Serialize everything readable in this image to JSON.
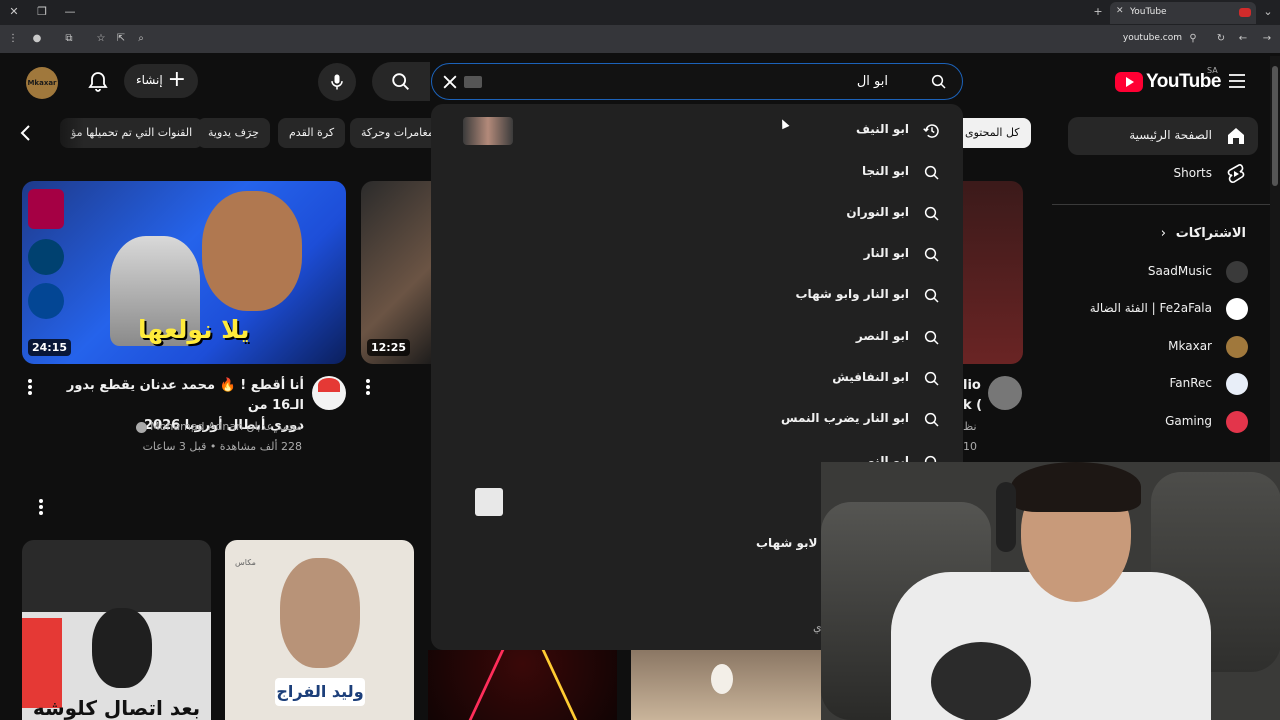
{
  "browser": {
    "tab_title": "YouTube",
    "url": "youtube.com"
  },
  "header": {
    "create_label": "إنشاء",
    "search_query": "ابو ال",
    "logo_text": "YouTube",
    "country_code": "SA",
    "avatar_label": "Mkaxar"
  },
  "chips": [
    {
      "label": "كل المحتوى"
    },
    {
      "label": "مغامرات وحركة"
    },
    {
      "label": "كرة القدم"
    },
    {
      "label": "حِرَف يدوية"
    },
    {
      "label": "القنوات التي تم تحميلها مؤ"
    }
  ],
  "sidebar": {
    "home": "الصفحة الرئيسية",
    "shorts": "Shorts",
    "subscriptions": "الاشتراكات",
    "channels": [
      {
        "name": "SaadMusic",
        "color": "#3a3a3a"
      },
      {
        "name": "Fe2aFala | الفئة الضالة",
        "color": "#ffffff"
      },
      {
        "name": "Mkaxar",
        "color": "#a0783c"
      },
      {
        "name": "FanRec",
        "color": "#e8eef8"
      },
      {
        "name": "Gaming",
        "color": "#e3354b"
      }
    ]
  },
  "suggestions": [
    {
      "text": "ابو النيف",
      "icon": "history-icon"
    },
    {
      "text": "ابو النجا",
      "icon": "search-icon"
    },
    {
      "text": "ابو النوران",
      "icon": "search-icon"
    },
    {
      "text": "ابو النار",
      "icon": "search-icon"
    },
    {
      "text": "ابو النار وابو شهاب",
      "icon": "search-icon"
    },
    {
      "text": "ابو النصر",
      "icon": "search-icon"
    },
    {
      "text": "ابو النفافيش",
      "icon": "search-icon"
    },
    {
      "text": "ابو النار يضرب النمس",
      "icon": "search-icon"
    },
    {
      "text": "ابو النو",
      "icon": "search-icon"
    }
  ],
  "dropdown_extra": {
    "partial_text": "لاح لابو شهاب",
    "edge_text": "ي"
  },
  "video1": {
    "duration": "24:15",
    "thumb_text": "يلا نولعها",
    "title_line1": "أنا أقطع ! 🔥 محمد عدنان يقطع بدور الـ16 من",
    "title_line2": "دوري أبطال أوروبا 2026",
    "channel": "محمد عدنان Mohamad Adnan",
    "stats": "228 ألف مشاهدة • قبل 3 ساعات"
  },
  "video2": {
    "duration": "12:25"
  },
  "video3": {
    "title_partial1": "lio",
    "title_partial2": "k (",
    "channel_partial": "نظ",
    "stats_partial": "10"
  },
  "short1": {
    "text": "بعد اتصال كلوشه"
  },
  "short2": {
    "text": "وليد الفراج",
    "brand": "مكاس"
  }
}
